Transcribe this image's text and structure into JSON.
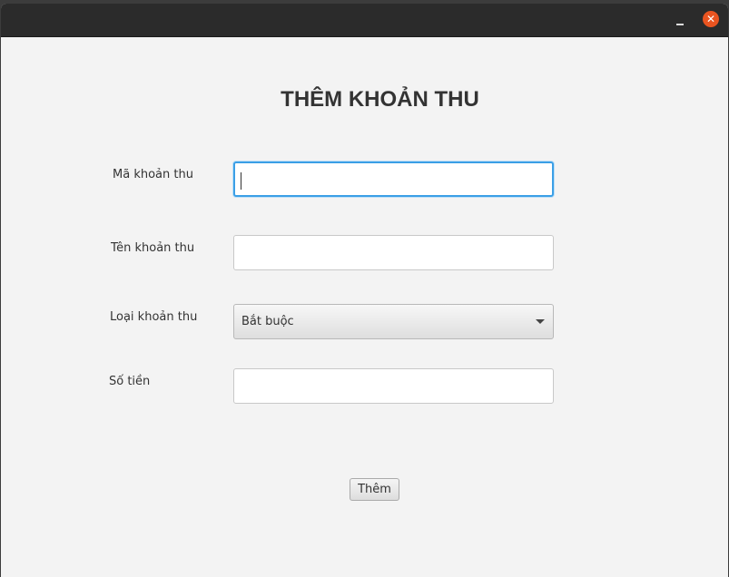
{
  "window": {
    "minimize_icon": "minimize-icon",
    "close_symbol": "✕",
    "close_color": "#e95420"
  },
  "form": {
    "title": "THÊM KHOẢN THU",
    "fields": [
      {
        "label": "Mã khoản thu",
        "value": "",
        "placeholder": ""
      },
      {
        "label": "Tên khoản thu",
        "value": "",
        "placeholder": ""
      },
      {
        "label": "Loại khoản thu",
        "selected": "Bắt buộc"
      },
      {
        "label": "Số tiền",
        "value": "",
        "placeholder": ""
      }
    ],
    "submit_label": "Thêm"
  },
  "colors": {
    "focus_ring": "#3b9fe6",
    "background": "#f3f3f3",
    "titlebar": "#2b2b2b"
  }
}
